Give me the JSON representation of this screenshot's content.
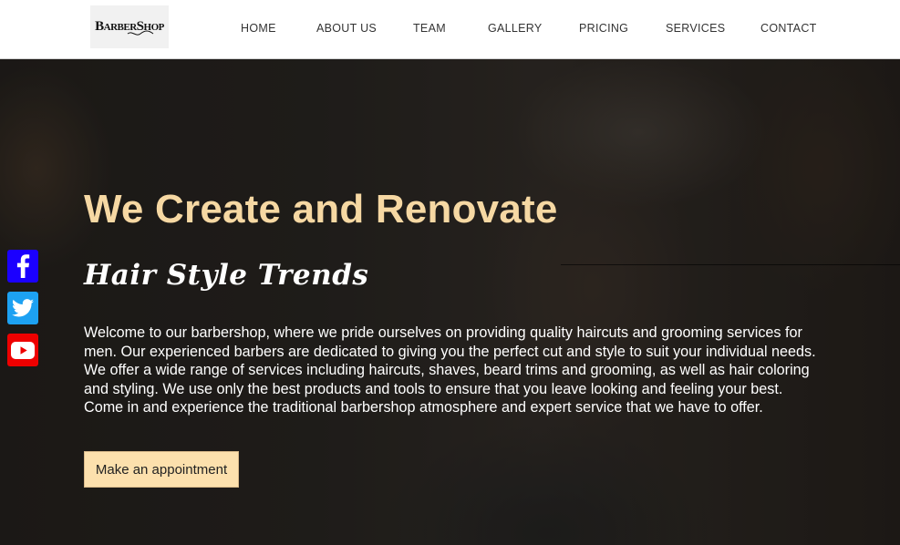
{
  "brand": {
    "logo_text": "BarberShop"
  },
  "nav": {
    "items": [
      {
        "label": "HOME"
      },
      {
        "label": "ABOUT US"
      },
      {
        "label": "TEAM"
      },
      {
        "label": "GALLERY"
      },
      {
        "label": "PRICING"
      },
      {
        "label": "SERVICES"
      },
      {
        "label": "CONTACT"
      }
    ]
  },
  "hero": {
    "headline": "We Create and Renovate",
    "subheadline": "Hair Style Trends",
    "intro": "Welcome to our barbershop, where we pride ourselves on providing quality haircuts and grooming services for men. Our experienced barbers are dedicated to giving you the perfect cut and style to suit your individual needs. We offer a wide range of services including haircuts, shaves, beard trims and grooming, as well as hair coloring and styling. We use only the best products and tools to ensure that you leave looking and feeling your best. Come in and experience the traditional barbershop atmosphere and expert service that we have to offer.",
    "cta_label": "Make an appointment"
  },
  "social": {
    "links": [
      {
        "icon": "facebook-icon",
        "color": "#1b00ff"
      },
      {
        "icon": "twitter-icon",
        "color": "#1da1f2"
      },
      {
        "icon": "youtube-icon",
        "color": "#ee0000"
      }
    ]
  },
  "colors": {
    "accent": "#f6d8a3",
    "button_bg": "#fce0ad",
    "nav_bg": "#ffffff",
    "nav_text": "#333333"
  }
}
